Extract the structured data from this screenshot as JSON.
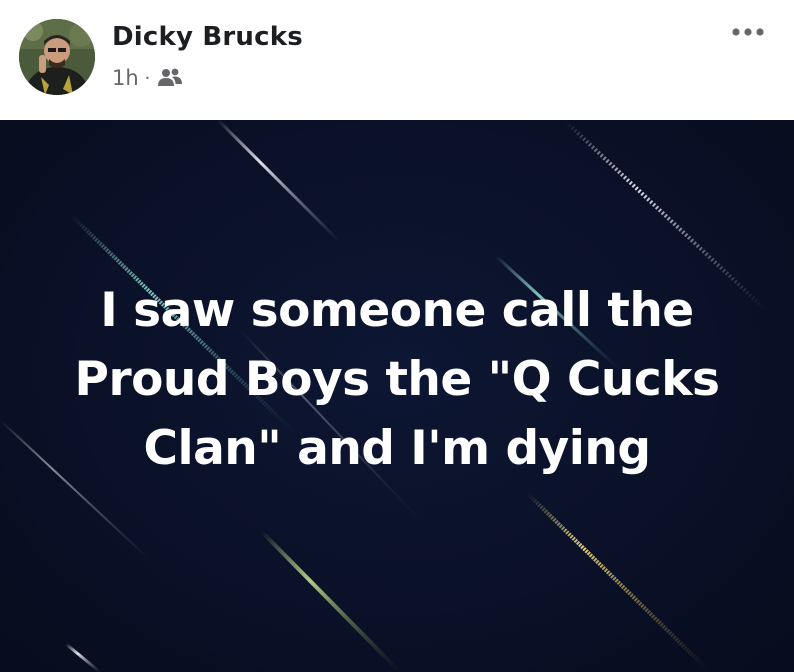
{
  "post": {
    "author_name": "Dicky Brucks",
    "timestamp": "1h",
    "separator": "·",
    "audience_icon": "friends-icon",
    "more_icon": "more-options-icon",
    "status_text": "I saw someone call the Proud Boys the \"Q Cucks Clan\" and I'm dying",
    "background_color": "#0a1128",
    "text_color": "#ffffff"
  }
}
